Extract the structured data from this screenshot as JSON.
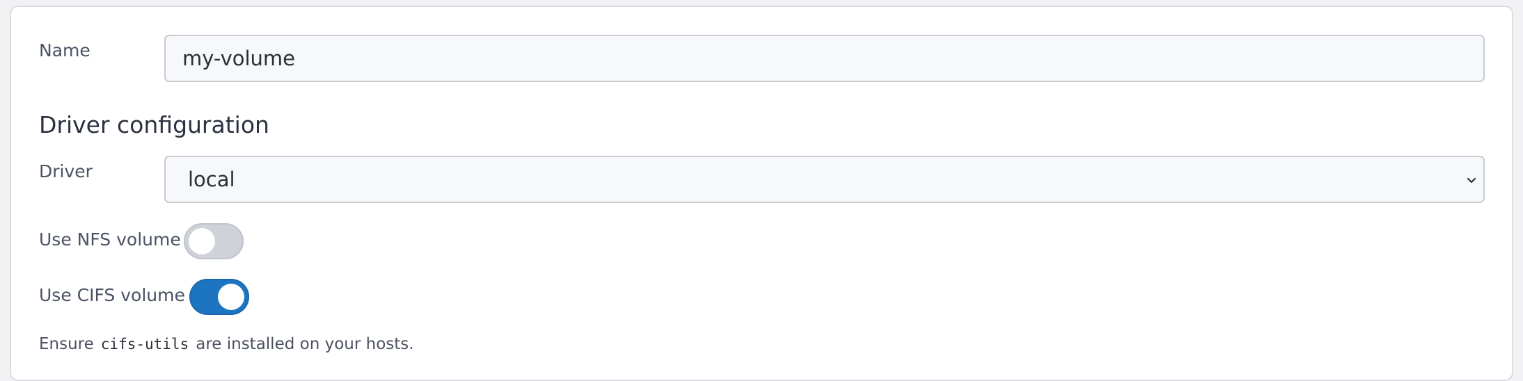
{
  "form": {
    "name_label": "Name",
    "name_value": "my-volume",
    "driver_section_title": "Driver configuration",
    "driver_label": "Driver",
    "driver_selected": "local",
    "nfs_label": "Use NFS volume",
    "nfs_enabled": false,
    "cifs_label": "Use CIFS volume",
    "cifs_enabled": true,
    "help_prefix": "Ensure",
    "help_code": "cifs-utils",
    "help_suffix": "are installed on your hosts."
  },
  "colors": {
    "toggle_on": "#1d74c0",
    "toggle_off": "#cfd2d9"
  },
  "icons": {
    "select_arrow": "chevron-down-icon"
  }
}
